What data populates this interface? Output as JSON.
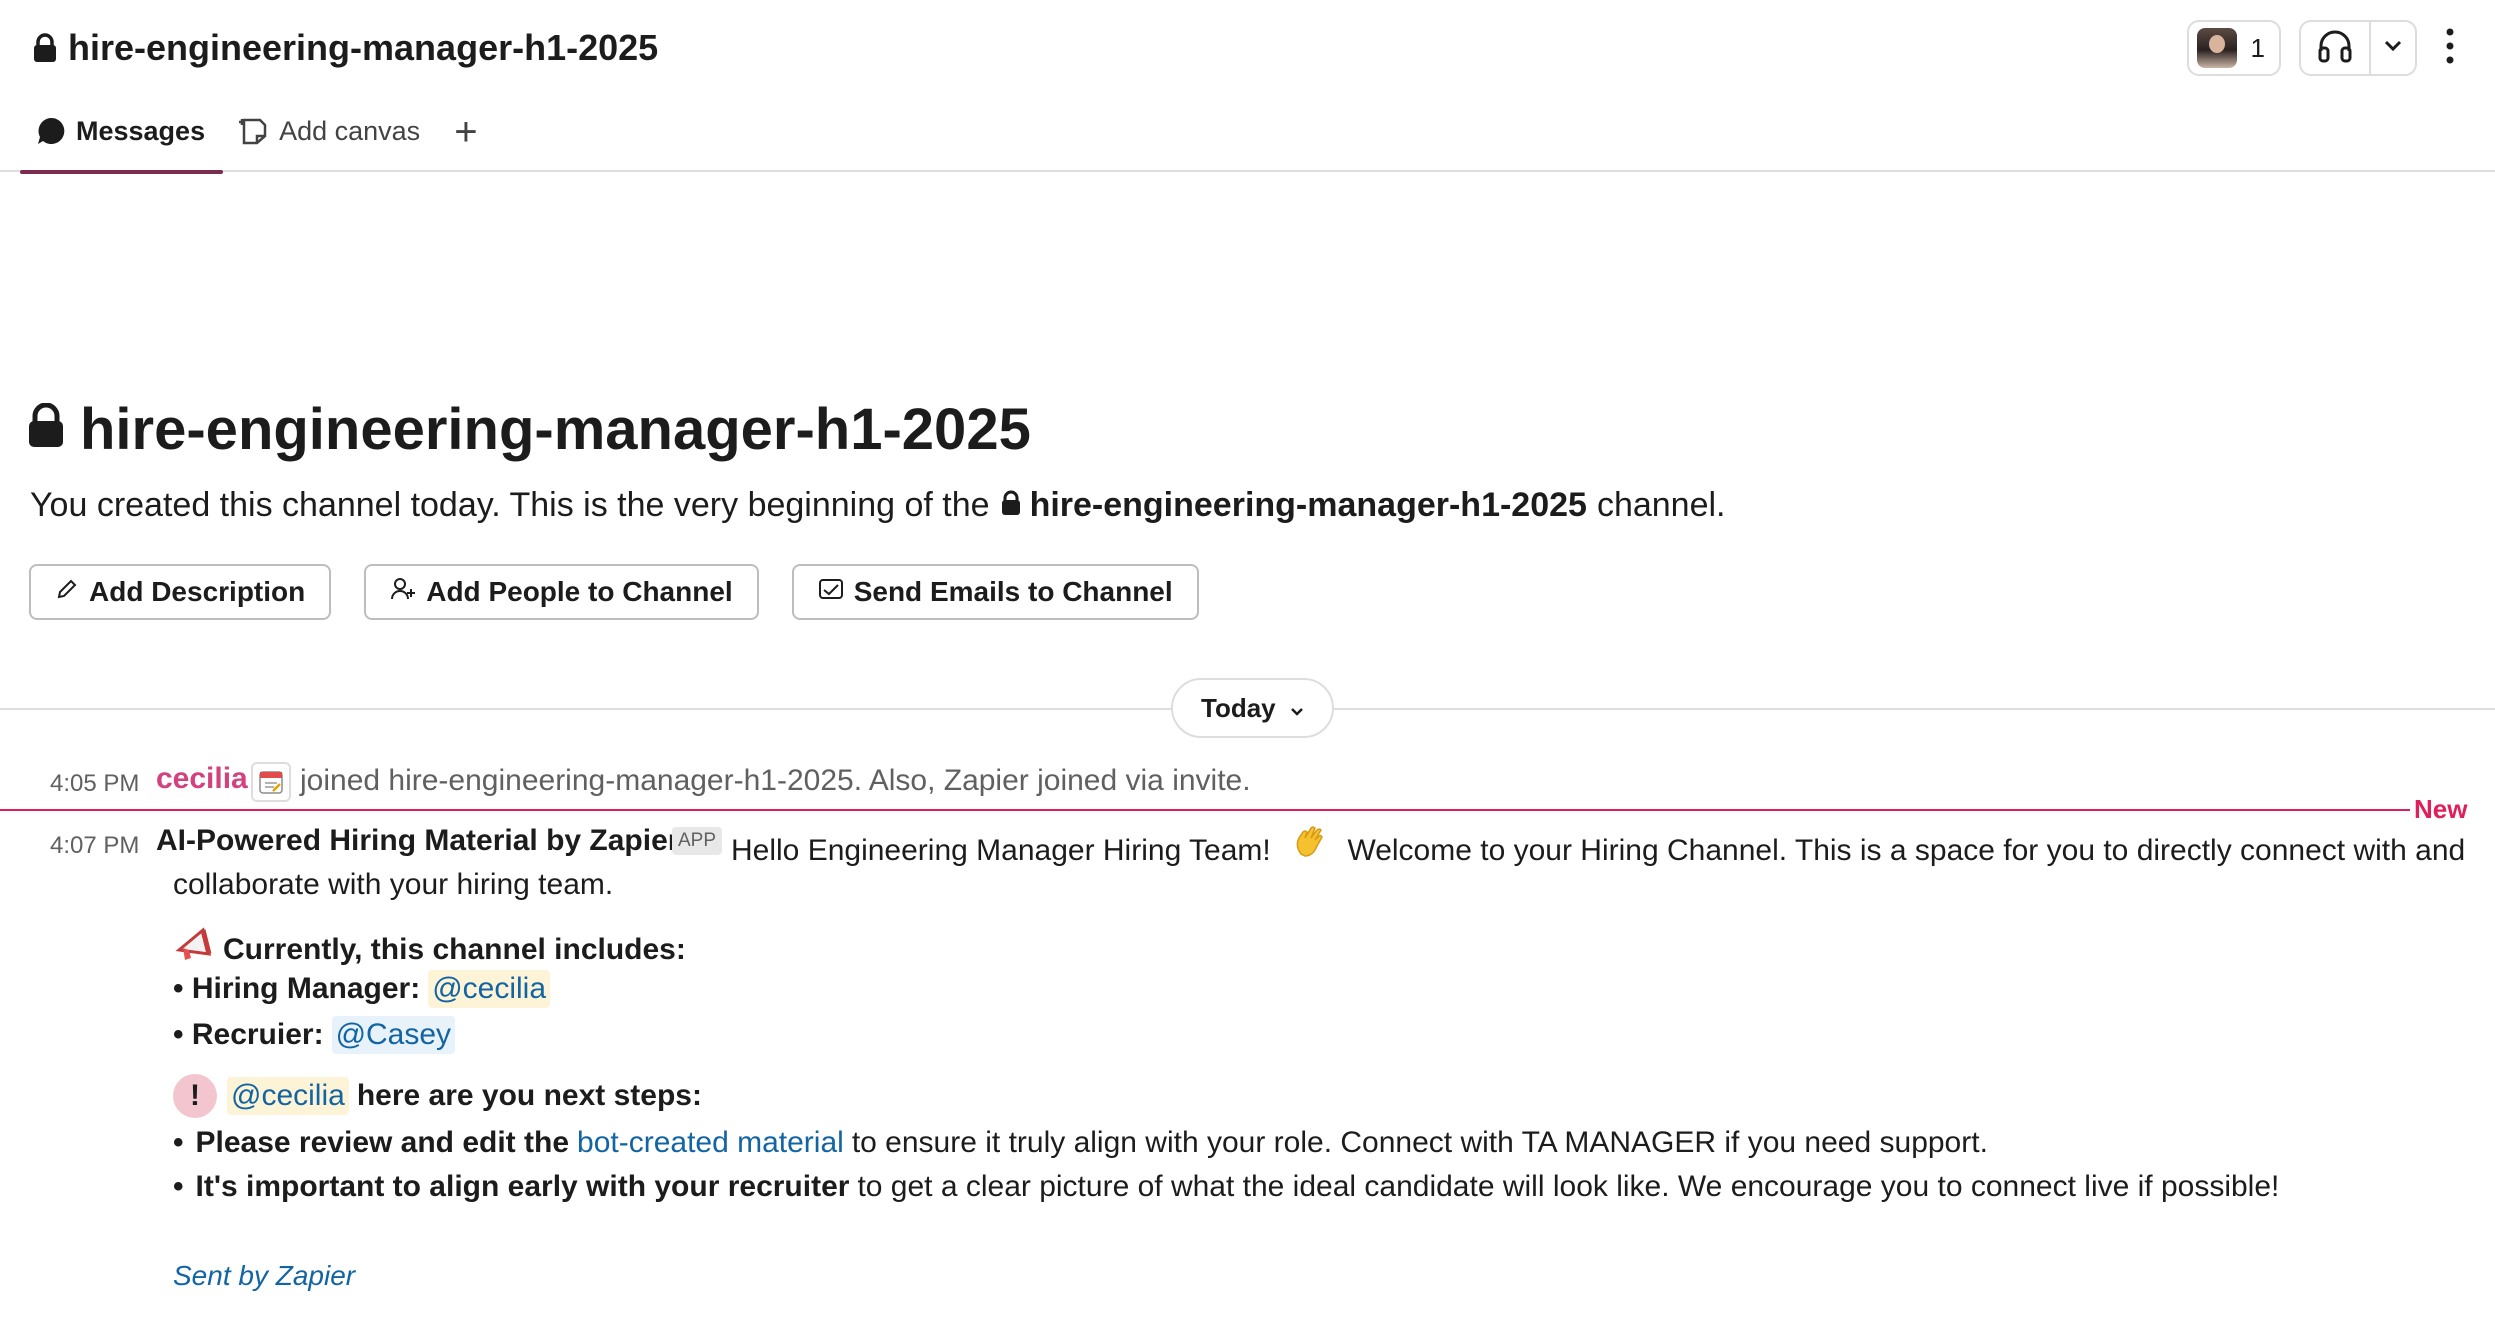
{
  "header": {
    "channel_name": "hire-engineering-manager-h1-2025",
    "member_count": "1",
    "tabs": [
      {
        "label": "Messages",
        "icon": "message-bubble-icon"
      },
      {
        "label": "Add canvas",
        "icon": "canvas-icon"
      }
    ]
  },
  "intro": {
    "title": "hire-engineering-manager-h1-2025",
    "text_before": "You created this channel today. This is the very beginning of the",
    "channel_name": "hire-engineering-manager-h1-2025",
    "text_after": "channel.",
    "buttons": {
      "add_description": "Add Description",
      "add_people": "Add People to Channel",
      "send_emails": "Send Emails to Channel"
    }
  },
  "divider": {
    "label": "Today"
  },
  "messages": {
    "join": {
      "time": "4:05 PM",
      "user": "cecilia",
      "text": "joined hire-engineering-manager-h1-2025. Also, Zapier joined via invite."
    },
    "new_label": "New",
    "bot": {
      "time": "4:07 PM",
      "sender": "AI-Powered Hiring Material by Zapier",
      "badge": "APP",
      "line1_a": "Hello Engineering Manager Hiring Team!",
      "line1_b": "Welcome to your Hiring Channel. This is a space for you to directly connect with and",
      "line2": "collaborate with your hiring team.",
      "includes_heading": "Currently, this channel includes:",
      "hiring_manager_label": "• Hiring Manager:",
      "hiring_manager_mention": "@cecilia",
      "recruiter_label": "• Recruier:",
      "recruiter_mention": "@Casey",
      "next_steps_mention": "@cecilia",
      "next_steps_text": "here are you next steps:",
      "step1_bold": "Please review and edit the",
      "step1_link": "bot-created material",
      "step1_rest": "to ensure it truly align with your role. Connect with TA MANAGER if you need support.",
      "step2_bold": "It's important to align early with your recruiter",
      "step2_rest": "to get a clear picture of what the ideal candidate will look like. We encourage you to connect live if possible!",
      "sent_by": "Sent by Zapier"
    }
  },
  "colors": {
    "accent_tab": "#7c2c4e",
    "new_line": "#e01e5a",
    "mention_user": "#d1427f",
    "link": "#1264a3"
  }
}
